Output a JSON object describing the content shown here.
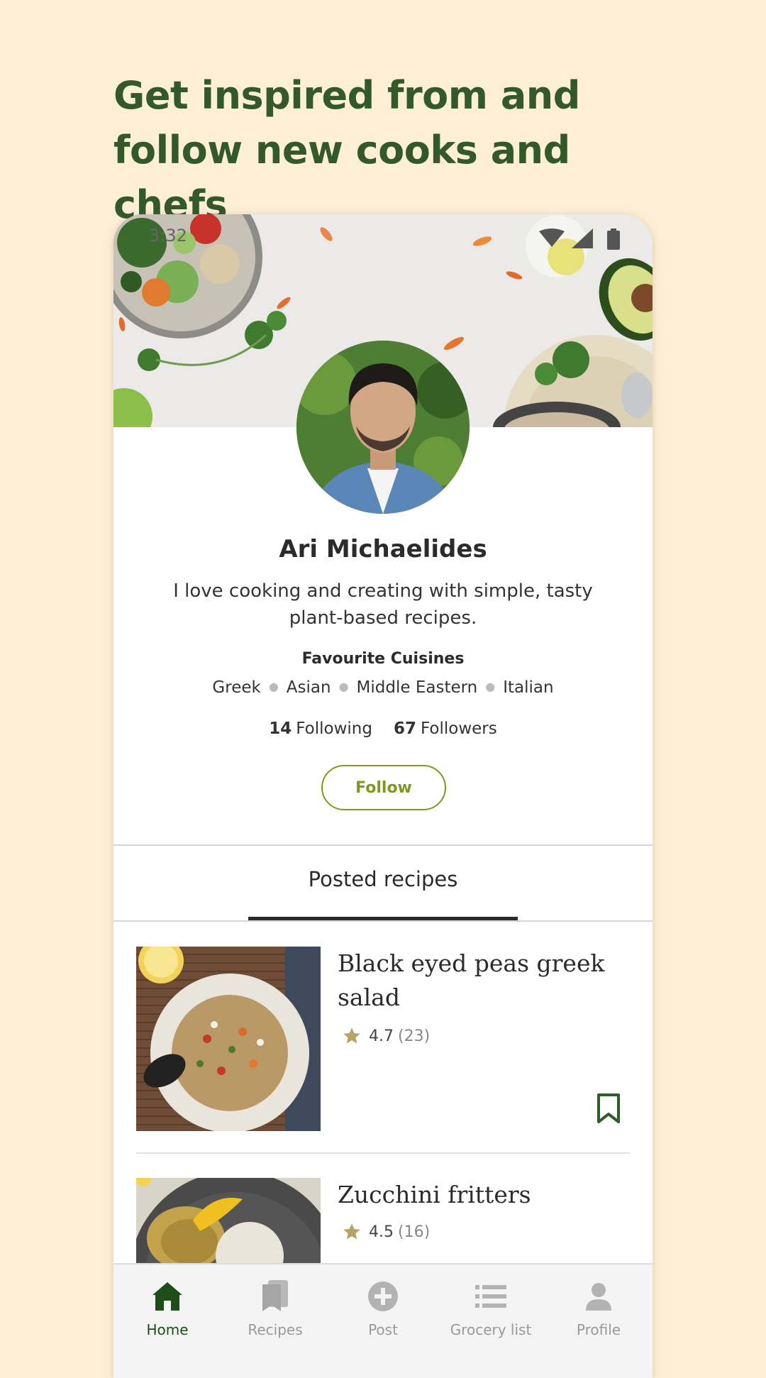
{
  "headline": "Get inspired from and follow new cooks and chefs",
  "status_bar": {
    "time": "3:32"
  },
  "profile": {
    "name": "Ari Michaelides",
    "bio": "I love cooking and creating with simple, tasty plant-based recipes.",
    "favourite_cuisines_title": "Favourite Cuisines",
    "cuisines": [
      "Greek",
      "Asian",
      "Middle Eastern",
      "Italian"
    ],
    "following_count": "14",
    "following_label": "Following",
    "followers_count": "67",
    "followers_label": "Followers",
    "follow_button": "Follow"
  },
  "tabs": {
    "posted_recipes": "Posted recipes"
  },
  "recipes": [
    {
      "title": "Black eyed peas greek salad",
      "rating": "4.7",
      "count": "(23)"
    },
    {
      "title": "Zucchini fritters",
      "rating": "4.5",
      "count": "(16)"
    }
  ],
  "nav": [
    {
      "label": "Home",
      "icon": "home-icon",
      "active": true
    },
    {
      "label": "Recipes",
      "icon": "recipes-icon",
      "active": false
    },
    {
      "label": "Post",
      "icon": "plus-circle-icon",
      "active": false
    },
    {
      "label": "Grocery list",
      "icon": "list-icon",
      "active": false
    },
    {
      "label": "Profile",
      "icon": "person-icon",
      "active": false
    }
  ],
  "colors": {
    "background": "#fdeed6",
    "headline": "#33592b",
    "accent": "#7c9a1c",
    "nav_active": "#1f4d1a",
    "star": "#b5a468"
  }
}
